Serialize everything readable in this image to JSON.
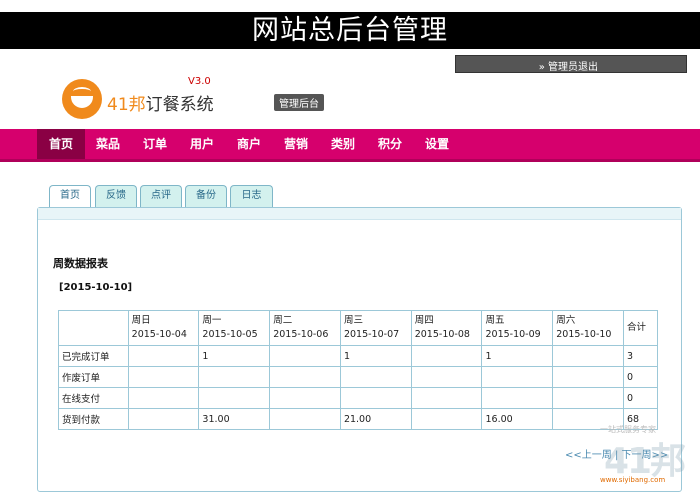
{
  "banner": {
    "title": "网站总后台管理"
  },
  "header": {
    "logout_text": "» 管理员退出",
    "logo_name_prefix": "41邦",
    "logo_name_suffix": "订餐系统",
    "logo_version": "V3.0",
    "admin_tag": "管理后台"
  },
  "nav": {
    "items": [
      "首页",
      "菜品",
      "订单",
      "用户",
      "商户",
      "营销",
      "类别",
      "积分",
      "设置"
    ]
  },
  "tabs": [
    "首页",
    "反馈",
    "点评",
    "备份",
    "日志"
  ],
  "report": {
    "title": "周数据报表",
    "date": "[2015-10-10]",
    "columns": [
      {
        "day": "周日",
        "date": "2015-10-04"
      },
      {
        "day": "周一",
        "date": "2015-10-05"
      },
      {
        "day": "周二",
        "date": "2015-10-06"
      },
      {
        "day": "周三",
        "date": "2015-10-07"
      },
      {
        "day": "周四",
        "date": "2015-10-08"
      },
      {
        "day": "周五",
        "date": "2015-10-09"
      },
      {
        "day": "周六",
        "date": "2015-10-10"
      }
    ],
    "total_label": "合计",
    "rows": [
      {
        "label": "已完成订单",
        "values": [
          "",
          "1",
          "",
          "1",
          "",
          "1",
          ""
        ],
        "total": "3"
      },
      {
        "label": "作废订单",
        "values": [
          "",
          "",
          "",
          "",
          "",
          "",
          ""
        ],
        "total": "0"
      },
      {
        "label": "在线支付",
        "values": [
          "",
          "",
          "",
          "",
          "",
          "",
          ""
        ],
        "total": "0"
      },
      {
        "label": "货到付款",
        "values": [
          "",
          "31.00",
          "",
          "21.00",
          "",
          "16.00",
          ""
        ],
        "total": "68"
      }
    ]
  },
  "pager": {
    "prev": "<<上一周",
    "sep": "|",
    "next": "下一周>>"
  },
  "watermark": {
    "line1": "一站式服务专家",
    "brand": "41邦",
    "url": "www.siyibang.com"
  }
}
